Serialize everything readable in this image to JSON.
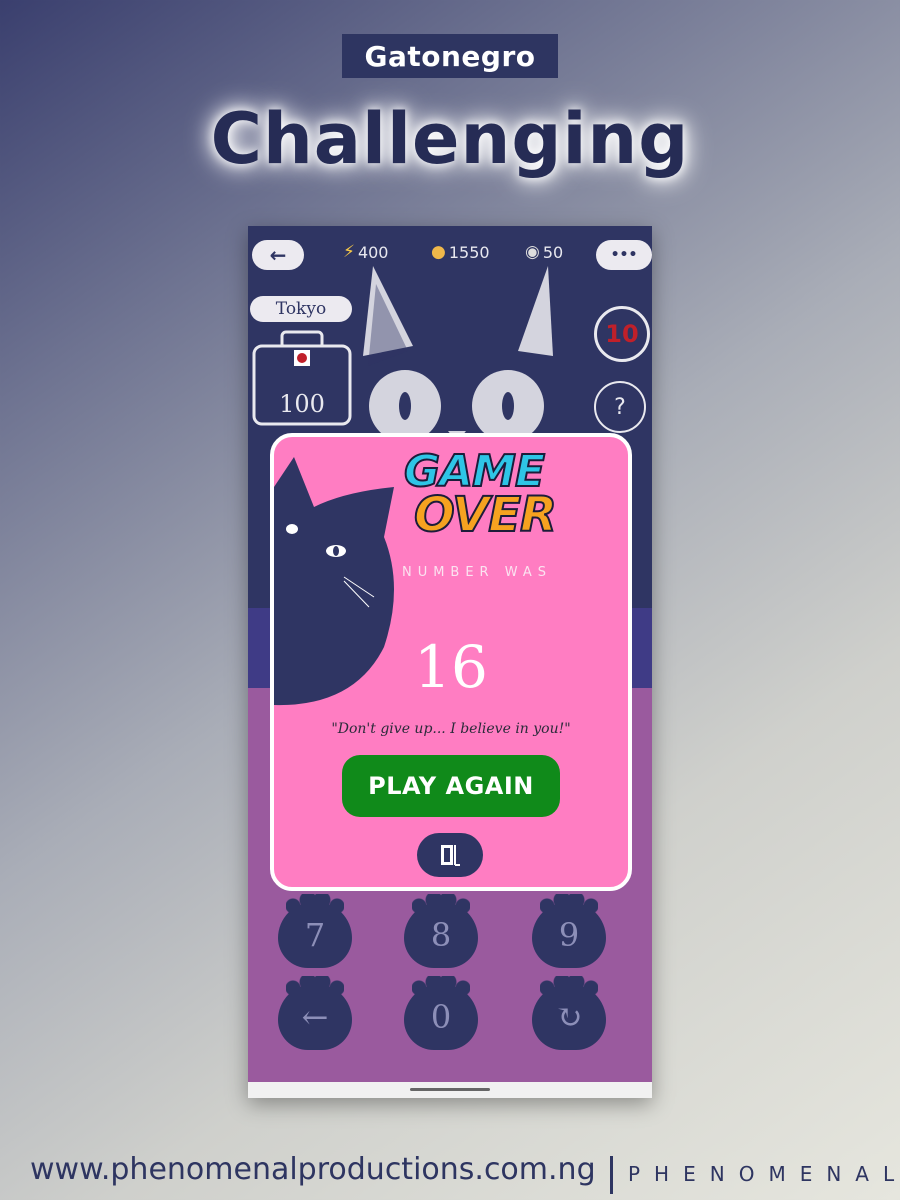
{
  "brand": {
    "tag": "Gatonegro",
    "headline": "Challenging"
  },
  "game": {
    "back_label": "←",
    "menu_label": "•••",
    "stats": {
      "energy": "400",
      "paws": "1550",
      "hints": "50"
    },
    "city": "Tokyo",
    "suitcase_value": "100",
    "timer_value": "10",
    "hint_icon": "?",
    "keypad": [
      "7",
      "8",
      "9",
      "←",
      "0",
      "↻"
    ]
  },
  "modal": {
    "title_line1": "GAME",
    "title_line2": "OVER",
    "subtitle": "NUMBER WAS",
    "answer": "16",
    "quote": "\"Don't give up... I believe in you!\"",
    "play_again_label": "PLAY AGAIN",
    "exit_icon": "exit-door-icon"
  },
  "footer": {
    "url": "www.phenomenalproductions.com.ng",
    "logo": "PHENOMENAL"
  },
  "colors": {
    "navy": "#2f3563",
    "pink": "#ff7dc2",
    "green_button": "#108a1a",
    "purple": "#9a5a9e",
    "timer_red": "#c0202a"
  }
}
